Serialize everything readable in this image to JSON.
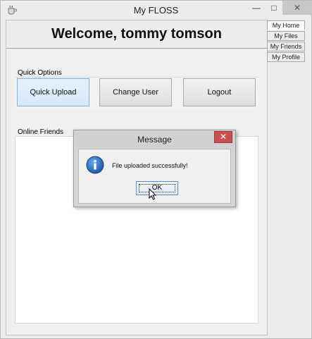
{
  "window": {
    "title": "My FLOSS",
    "minimize_glyph": "—",
    "maximize_glyph": "□",
    "close_glyph": "✕",
    "icon": "java-cup-icon"
  },
  "header": {
    "welcome": "Welcome, tommy tomson"
  },
  "quick_options": {
    "label": "Quick Options",
    "buttons": [
      "Quick Upload",
      "Change User",
      "Logout"
    ],
    "active": "Quick Upload"
  },
  "online_friends": {
    "label": "Online Friends",
    "items": []
  },
  "tabs": {
    "items": [
      "My Home",
      "My Files",
      "My Friends",
      "My Profile"
    ],
    "selected": "My Home"
  },
  "dialog": {
    "title": "Message",
    "close_glyph": "✕",
    "message": "File uploaded successfully!",
    "ok_label": "OK",
    "icon": "info-icon"
  },
  "colors": {
    "dialog_close": "#c75050",
    "active_button": "#7eb4ea",
    "info_icon": "#1e5aa8"
  }
}
